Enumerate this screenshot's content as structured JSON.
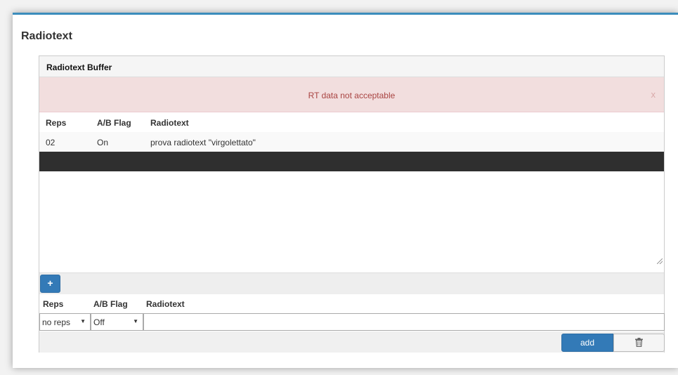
{
  "card": {
    "title": "Radiotext"
  },
  "buffer": {
    "heading": "Radiotext Buffer",
    "alert": {
      "message": "RT data not acceptable",
      "close": "x"
    },
    "columns": [
      "Reps",
      "A/B Flag",
      "Radiotext"
    ],
    "rows": [
      {
        "reps": "02",
        "ab_flag": "On",
        "radiotext": "prova radiotext \"virgolettato\""
      }
    ]
  },
  "toolbar": {
    "add_icon": "plus-icon",
    "add_symbol": "+"
  },
  "form": {
    "columns": [
      "Reps",
      "A/B Flag",
      "Radiotext"
    ],
    "reps_select": {
      "value": "no reps"
    },
    "ab_select": {
      "value": "Off"
    },
    "radiotext_input": {
      "value": ""
    },
    "add_label": "add",
    "delete_icon": "trash-icon"
  },
  "colors": {
    "accent": "#337ab7",
    "alert_bg": "#f2dede",
    "alert_text": "#a94442",
    "selected_row": "#2f2f2f"
  }
}
